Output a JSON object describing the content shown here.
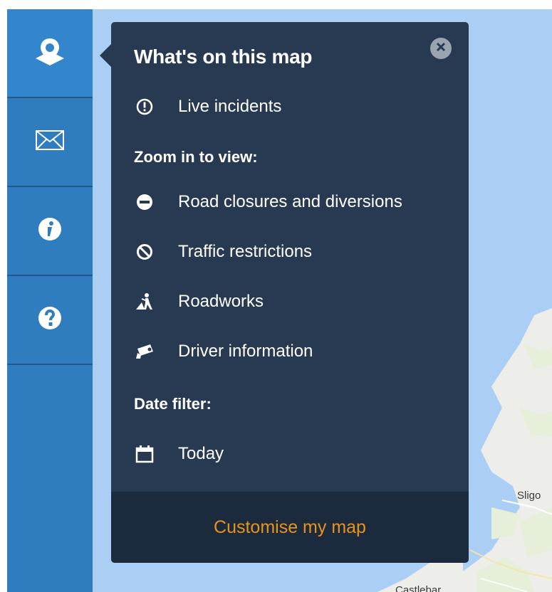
{
  "sidebar": {
    "items": [
      {
        "icon": "map-pin-icon"
      },
      {
        "icon": "envelope-icon"
      },
      {
        "icon": "info-icon"
      },
      {
        "icon": "help-icon"
      }
    ]
  },
  "panel": {
    "title": "What's on this map",
    "live_label": "Live incidents",
    "zoom_heading": "Zoom in to view:",
    "zoom_items": [
      {
        "label": "Road closures and diversions",
        "icon": "no-entry-icon"
      },
      {
        "label": "Traffic restrictions",
        "icon": "prohibited-icon"
      },
      {
        "label": "Roadworks",
        "icon": "roadworks-icon"
      },
      {
        "label": "Driver information",
        "icon": "camera-icon"
      }
    ],
    "date_heading": "Date filter:",
    "date_value": "Today",
    "footer_link": "Customise my map"
  },
  "map": {
    "labels": {
      "sligo": "Sligo",
      "castlebar": "Castlebar"
    }
  },
  "colors": {
    "sidebar": "#2f7cbf",
    "panel": "#283a51",
    "footer": "#1b2a3c",
    "link": "#e8941c",
    "water": "#abcef5"
  }
}
